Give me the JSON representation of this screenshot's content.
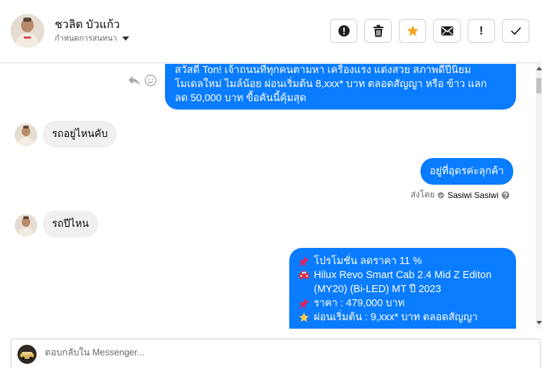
{
  "header": {
    "contact_name": "ชวลิต บัวแก้ว",
    "assign_label": "กำหนดการสนทนา",
    "actions": [
      {
        "name": "report-spam-button",
        "icon": "exclamation-circle-icon"
      },
      {
        "name": "delete-button",
        "icon": "trash-icon"
      },
      {
        "name": "star-button",
        "icon": "star-icon"
      },
      {
        "name": "mark-unread-button",
        "icon": "envelope-icon"
      },
      {
        "name": "follow-up-button",
        "icon": "exclamation-icon",
        "text": "!"
      },
      {
        "name": "mark-done-button",
        "icon": "checkmark-icon"
      }
    ],
    "accent_star": "#f5a623"
  },
  "messages": [
    {
      "direction": "outgoing",
      "lines": [
        "สวัสดี Ton! เจ้าถนนที่ทุกคนตามหา เครื่องแรง แต่งสวย สภาพดีปีนิยม",
        "โมเดลใหม่ ไมล์น้อย ผ่อนเริ่มต้น 8,xxx* บาท ตลอดสัญญา หรือ ข้าว แลก",
        "ลด 50,000 บาท ขื้อคันนี้คุ้มสุด"
      ]
    },
    {
      "direction": "incoming",
      "text": "รถอยู่ไหนคับ"
    },
    {
      "direction": "outgoing",
      "text": "อยู่ที่อุดรค่ะลุกค้า"
    },
    {
      "direction": "incoming",
      "text": "รถปีไหน"
    },
    {
      "direction": "outgoing",
      "lines": [
        {
          "icon": "pushpin-icon",
          "text": "โปรโมชั่น ลดราคา 11 %"
        },
        {
          "icon": "car-icon",
          "text": "Hilux Revo Smart Cab 2.4 Mid Z Editon"
        },
        {
          "icon": "",
          "text": "(MY20) (Bi-LED) MT ปี 2023"
        },
        {
          "icon": "pushpin-icon",
          "text": "ราคา : 479,000 บาท"
        },
        {
          "icon": "star-icon",
          "text": "ผ่อนเริ่มต้น : 9,xxx* บาท ตลอดสัญญา"
        }
      ]
    }
  ],
  "sent_by": {
    "prefix": "ส่งโดย",
    "agent": "Sasiwi Sasiwi"
  },
  "composer": {
    "placeholder": "ตอบกลับใน Messenger..."
  },
  "colors": {
    "outgoing_bubble": "#0a7cff",
    "incoming_bubble": "#f0f0f0"
  }
}
